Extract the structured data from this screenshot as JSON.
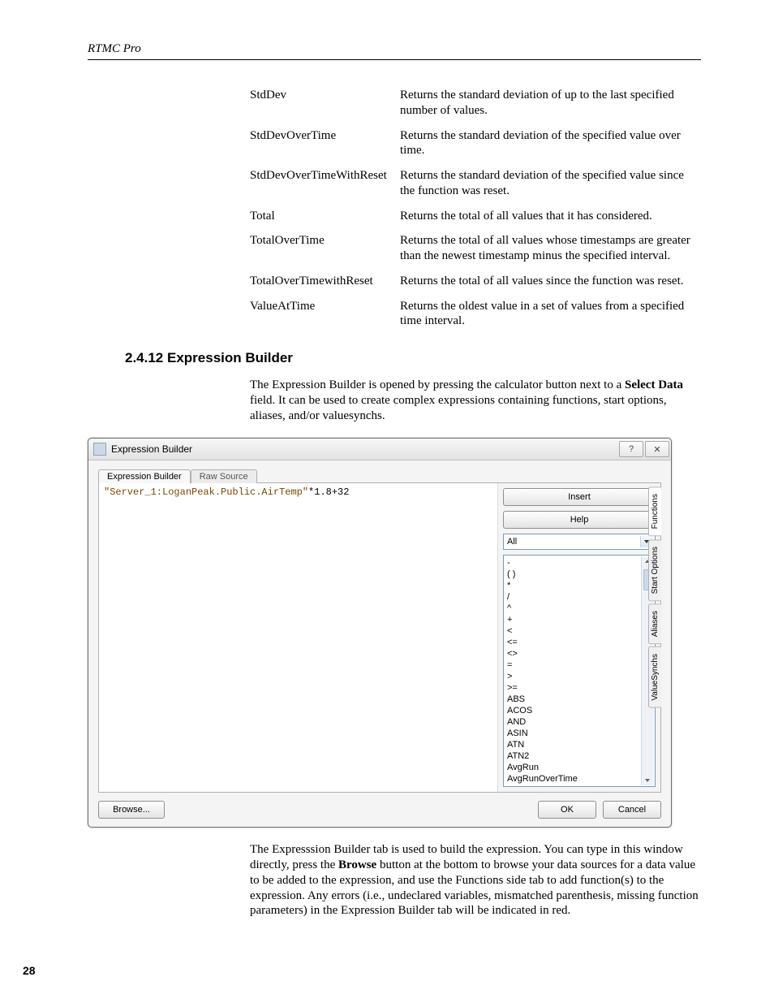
{
  "running_head": "RTMC Pro",
  "page_number": "28",
  "definitions": [
    {
      "term": "StdDev",
      "desc": "Returns the standard deviation of up to the last specified number of values."
    },
    {
      "term": "StdDevOverTime",
      "desc": "Returns the standard deviation of the specified value over time."
    },
    {
      "term": "StdDevOverTimeWithReset",
      "desc": "Returns the standard deviation of the specified value since the function was reset."
    },
    {
      "term": "Total",
      "desc": "Returns the total of all values that it has considered."
    },
    {
      "term": "TotalOverTime",
      "desc": "Returns the total of all values whose timestamps are greater than the newest timestamp minus the specified interval."
    },
    {
      "term": "TotalOverTimewithReset",
      "desc": "Returns the total of all values since the function was reset."
    },
    {
      "term": "ValueAtTime",
      "desc": "Returns the oldest value in a set of values from a specified time interval."
    }
  ],
  "section_heading": "2.4.12  Expression Builder",
  "intro_pre": "The Expression Builder is opened by pressing the calculator button next to a ",
  "intro_bold1": "Select Data",
  "intro_post": " field.  It can be used to create complex expressions containing functions, start options, aliases, and/or valuesynchs.",
  "dialog": {
    "title": "Expression Builder",
    "help_glyph": "?",
    "close_glyph": "✕",
    "tabs": {
      "builder": "Expression Builder",
      "raw": "Raw Source"
    },
    "expr_string": "\"Server_1:LoganPeak.Public.AirTemp\"",
    "expr_tail": "*1.8+32",
    "insert_btn": "Insert",
    "help_btn": "Help",
    "combo_value": "All",
    "func_list": [
      "-",
      "( )",
      "*",
      "/",
      "^",
      "+",
      "<",
      "<=",
      "<>",
      "=",
      ">",
      ">=",
      "ABS",
      "ACOS",
      "AND",
      "ASIN",
      "ATN",
      "ATN2",
      "AvgRun",
      "AvgRunOverTime"
    ],
    "side_tabs": [
      "Functions",
      "Start Options",
      "Aliases",
      "ValueSynchs"
    ],
    "browse_btn": "Browse...",
    "ok_btn": "OK",
    "cancel_btn": "Cancel"
  },
  "outro_pre": "The Expresssion Builder tab is used to build the expression.  You can type in this window directly, press the ",
  "outro_bold": "Browse",
  "outro_post": " button at the bottom to browse your data sources for a data value to be added to the expression, and use the Functions side tab to add function(s) to the expression.  Any errors (i.e., undeclared variables, mismatched parenthesis, missing function parameters) in the Expression Builder tab will be indicated in red."
}
